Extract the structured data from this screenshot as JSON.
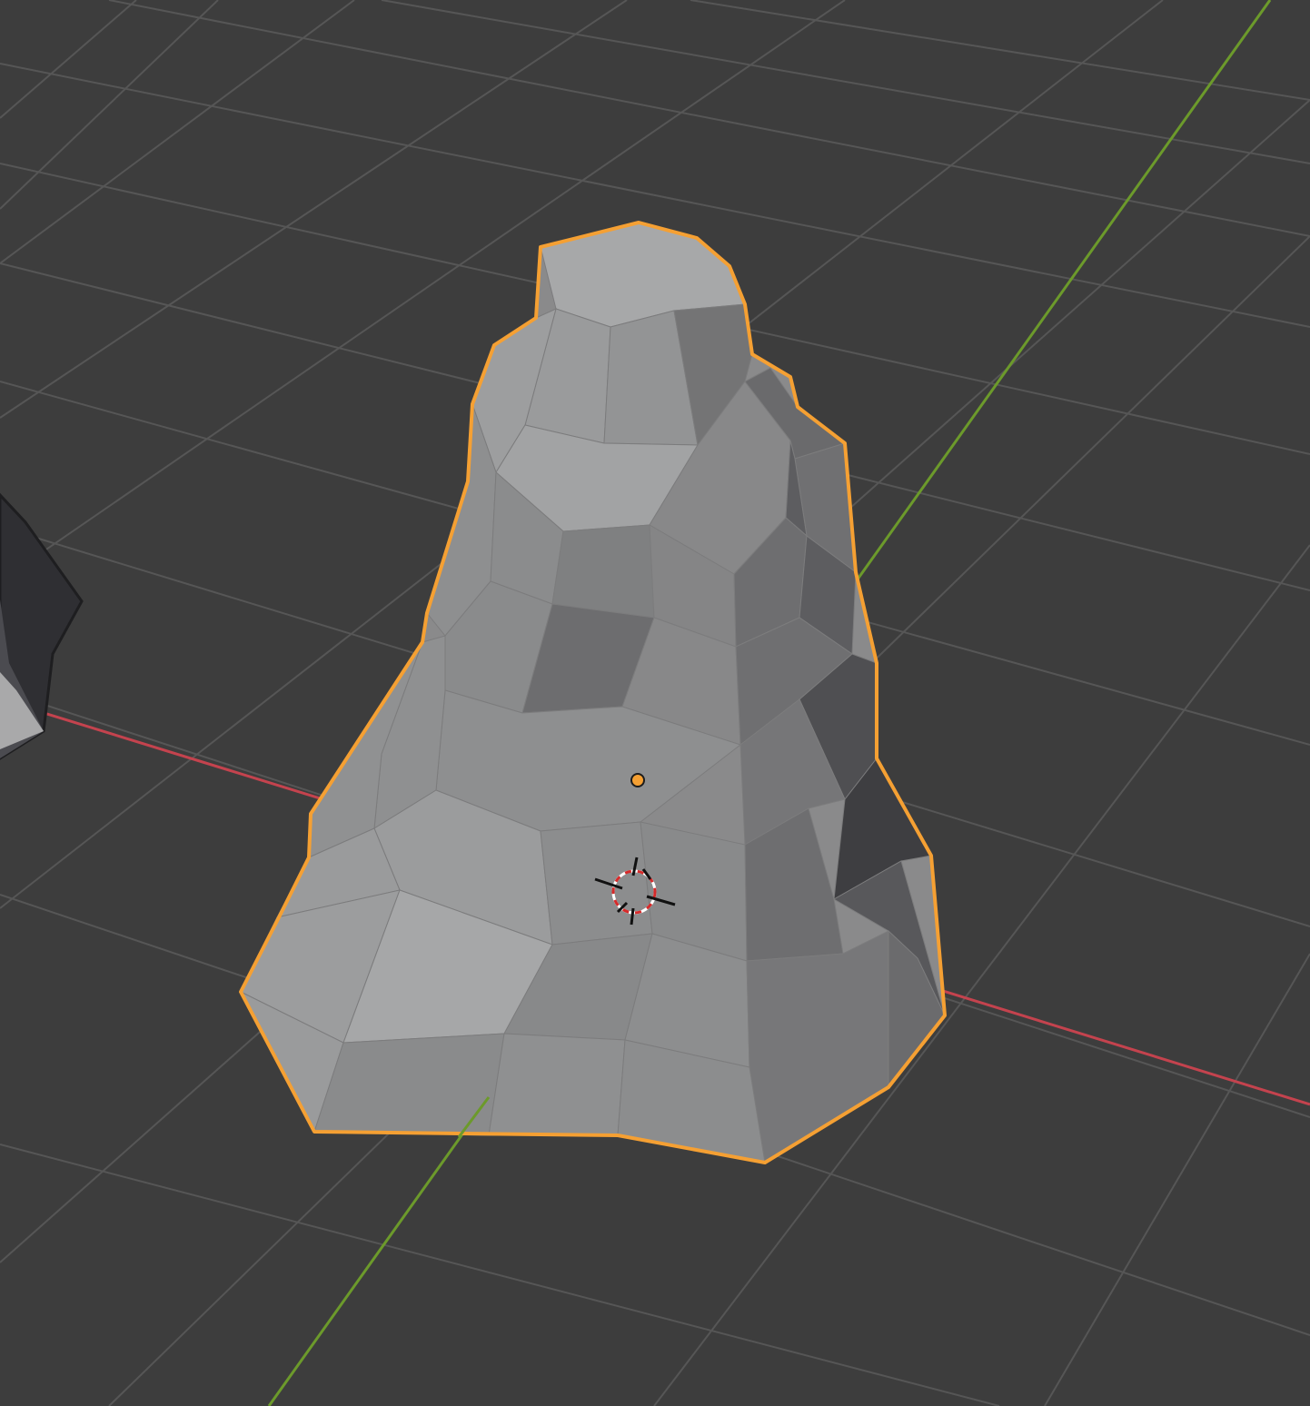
{
  "viewport": {
    "view": "3D Viewport",
    "shading": "solid",
    "background_color": "#3d3d3d"
  },
  "colors": {
    "grid_line": "#545454",
    "x_axis": "#c4434e",
    "y_axis": "#6c9a2b",
    "selection_outline": "#f5a033",
    "origin_dot": "#f5a033",
    "cursor_red": "#d62a2a"
  },
  "scene": {
    "selected_object": {
      "type": "rock",
      "selected": true,
      "active": true
    },
    "other_object": {
      "type": "mesh",
      "selected": false
    },
    "cursor": {
      "name": "3d-cursor"
    },
    "origin": {
      "name": "object-origin"
    }
  }
}
